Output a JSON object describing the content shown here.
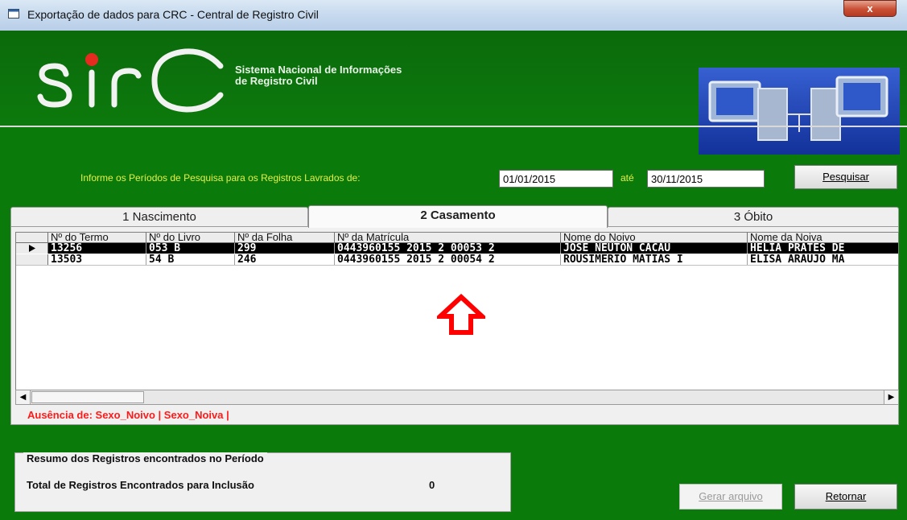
{
  "window": {
    "title": "Exportação de dados para CRC  - Central de Registro Civil",
    "close_label": "x"
  },
  "banner": {
    "logo_text": "sirc",
    "tagline_line1": "Sistema Nacional de Informações",
    "tagline_line2": "de Registro Civil"
  },
  "search": {
    "label": "Informe os Períodos de Pesquisa para os Registros Lavrados de:",
    "from_value": "01/01/2015",
    "ate_label": "até",
    "to_value": "30/11/2015",
    "button_label": "Pesquisar"
  },
  "tabs": [
    {
      "label": "1 Nascimento",
      "active": false
    },
    {
      "label": "2 Casamento",
      "active": true
    },
    {
      "label": "3 Óbito",
      "active": false
    }
  ],
  "grid": {
    "columns": [
      "Nº do Termo",
      "Nº do Livro",
      "Nº da Folha",
      "Nº da Matrícula",
      "Nome do Noivo",
      "Nome da Noiva"
    ],
    "rows": [
      {
        "selected": true,
        "cells": [
          "13256",
          "053 B",
          "299",
          "0443960155 2015 2 00053 2",
          "JOSÉ NEUTON CACAU",
          "HELIA PRATES DE"
        ]
      },
      {
        "selected": false,
        "cells": [
          "13503",
          "54 B",
          "246",
          "0443960155 2015 2 00054 2",
          "ROUSIMÉRIO MATIAS I",
          "ELISA ARAÚJO MA"
        ]
      }
    ]
  },
  "missing_fields": "Ausência de: Sexo_Noivo | Sexo_Noiva |",
  "summary": {
    "title": "Resumo dos Registros encontrados no Período",
    "label": "Total de Registros Encontrados para Inclusão",
    "count": "0"
  },
  "buttons": {
    "gerar": "Gerar arquivo",
    "retornar": "Retornar"
  },
  "colors": {
    "background_green": "#0a7a0a",
    "label_yellow": "#e6ef4a",
    "warning_red": "#ff1a1a"
  }
}
